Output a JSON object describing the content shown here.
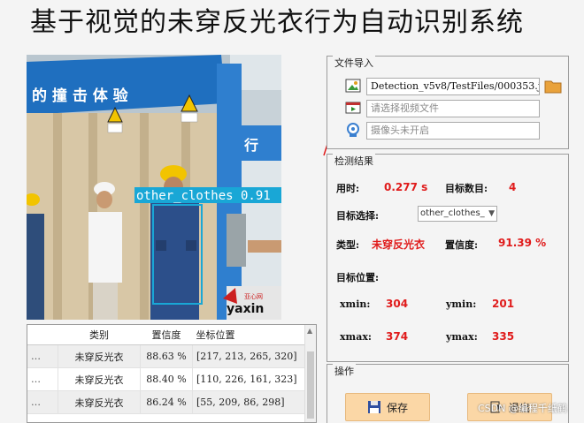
{
  "window": {
    "title": "基于视觉的未穿反光衣行为自动识别系统"
  },
  "image_panel": {
    "sign_text": "的 撞 击 体 验",
    "sign_right": "行",
    "detection_label": "other_clothes 0.91",
    "logo_text": "yaxin",
    "logo_sub": "亚心网"
  },
  "table": {
    "headers": [
      "",
      "类别",
      "置信度",
      "坐标位置"
    ],
    "rows": [
      [
        "…",
        "未穿反光衣",
        "88.63 %",
        "[217, 213, 265, 320]"
      ],
      [
        "…",
        "未穿反光衣",
        "88.40 %",
        "[110, 226, 161, 323]"
      ],
      [
        "…",
        "未穿反光衣",
        "86.24 %",
        "[55, 209, 86, 298]"
      ]
    ]
  },
  "file_import": {
    "title": "文件导入",
    "image_path": "Detection_v5v8/TestFiles/000353.jpg",
    "video_placeholder": "请选择视频文件",
    "camera_placeholder": "摄像头未开启"
  },
  "results": {
    "title": "检测结果",
    "time_label": "用时:",
    "time_value": "0.277 s",
    "count_label": "目标数目:",
    "count_value": "4",
    "select_label": "目标选择:",
    "select_value": "other_clothes_",
    "type_label": "类型:",
    "type_value": "未穿反光衣",
    "conf_label": "置信度:",
    "conf_value": "91.39 %",
    "pos_label": "目标位置:",
    "xmin_label": "xmin:",
    "xmin_value": "304",
    "ymin_label": "ymin:",
    "ymin_value": "201",
    "xmax_label": "xmax:",
    "xmax_value": "374",
    "ymax_label": "ymax:",
    "ymax_value": "335"
  },
  "operations": {
    "title": "操作",
    "save_label": "保存",
    "exit_label": "退出"
  },
  "watermark": "CSDN @编程千纸鹤",
  "colors": {
    "accent_red": "#e01b1b",
    "button_bg": "#fbd7a6",
    "detect_box": "#19a7d6"
  }
}
